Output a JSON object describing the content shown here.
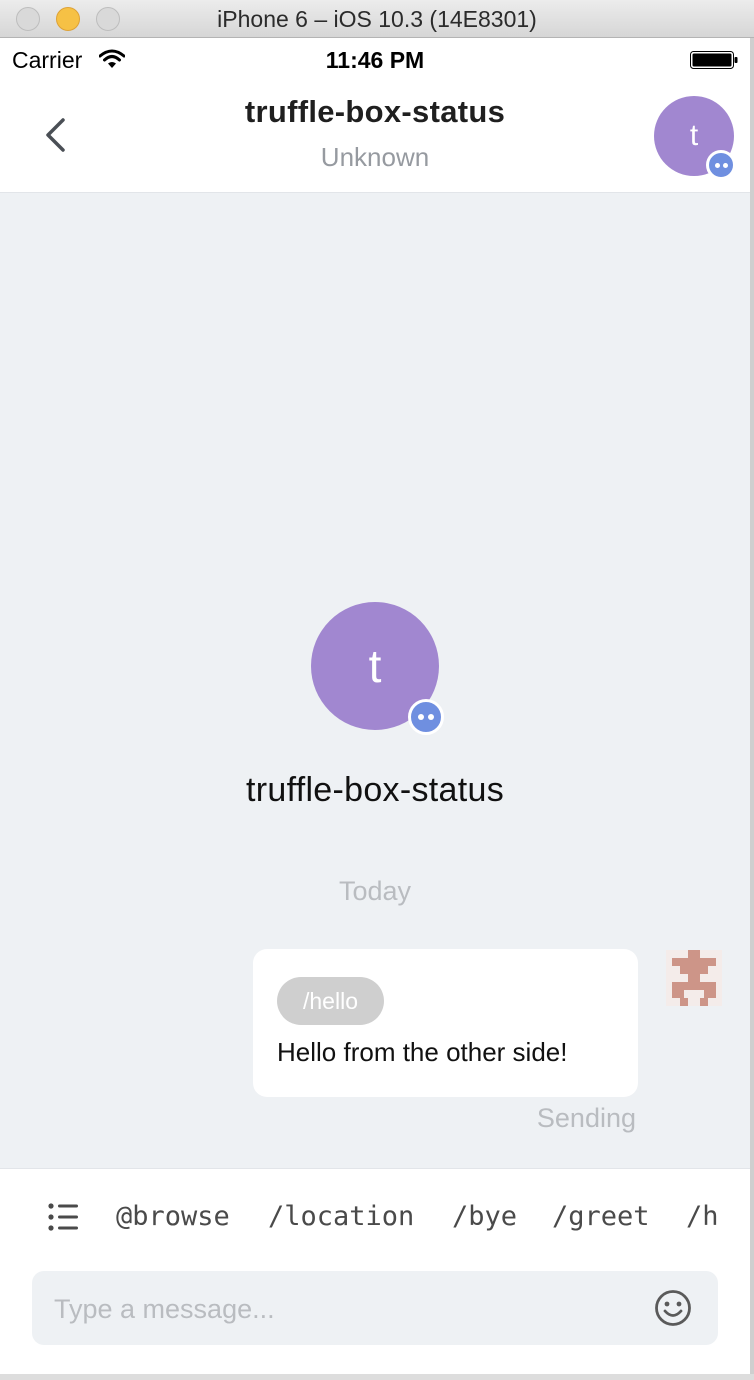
{
  "window": {
    "title": "iPhone 6 – iOS 10.3 (14E8301)"
  },
  "status_bar": {
    "carrier": "Carrier",
    "time": "11:46 PM"
  },
  "nav": {
    "title": "truffle-box-status",
    "subtitle": "Unknown",
    "avatar_initial": "t"
  },
  "profile": {
    "avatar_initial": "t",
    "name": "truffle-box-status"
  },
  "chat": {
    "date_separator": "Today",
    "messages": [
      {
        "command": "/hello",
        "text": "Hello from the other side!",
        "status": "Sending",
        "outgoing": true
      }
    ]
  },
  "composer": {
    "suggestions": [
      "@browse",
      "/location",
      "/bye",
      "/greet",
      "/h"
    ],
    "placeholder": "Type a message..."
  },
  "colors": {
    "avatar": "#a187d0",
    "badge": "#6f8fe0",
    "chat_bg": "#eef1f4"
  },
  "icons": [
    "back-chevron-icon",
    "wifi-icon",
    "battery-icon",
    "chat-badge-icon",
    "list-icon",
    "emoji-icon",
    "identicon-avatar"
  ]
}
